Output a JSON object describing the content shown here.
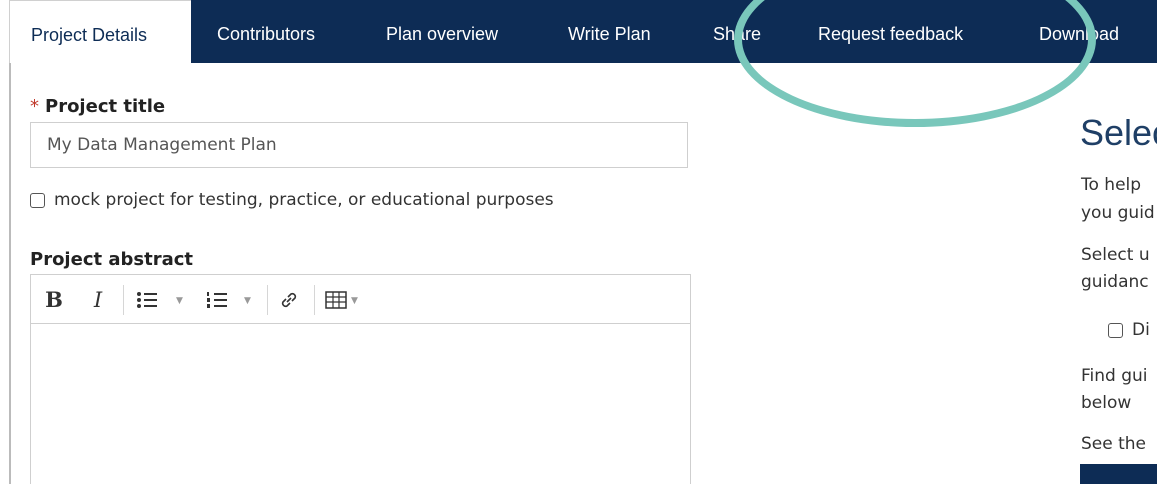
{
  "tabs": [
    {
      "label": "Project Details",
      "active": true
    },
    {
      "label": "Contributors"
    },
    {
      "label": "Plan overview"
    },
    {
      "label": "Write Plan"
    },
    {
      "label": "Share"
    },
    {
      "label": "Request feedback"
    },
    {
      "label": "Download"
    }
  ],
  "form": {
    "required_marker": "*",
    "project_title_label": "Project title",
    "project_title_value": "My Data Management Plan",
    "mock_project_label": "mock project for testing, practice, or educational purposes",
    "abstract_label": "Project abstract"
  },
  "editor_toolbar": {
    "bold": "B",
    "italic": "I",
    "icons": [
      "bold-icon",
      "italic-icon",
      "bulleted-list-icon",
      "numbered-list-icon",
      "link-icon",
      "table-icon"
    ]
  },
  "right_panel": {
    "title": "Selec",
    "lines": [
      "To help",
      "you guid",
      "Select u",
      "guidanc",
      "Di",
      "Find gui",
      "below",
      "See the"
    ]
  },
  "colors": {
    "nav_bg": "#0d2c55",
    "annotation": "#79c7bb",
    "required": "#c0392b"
  }
}
